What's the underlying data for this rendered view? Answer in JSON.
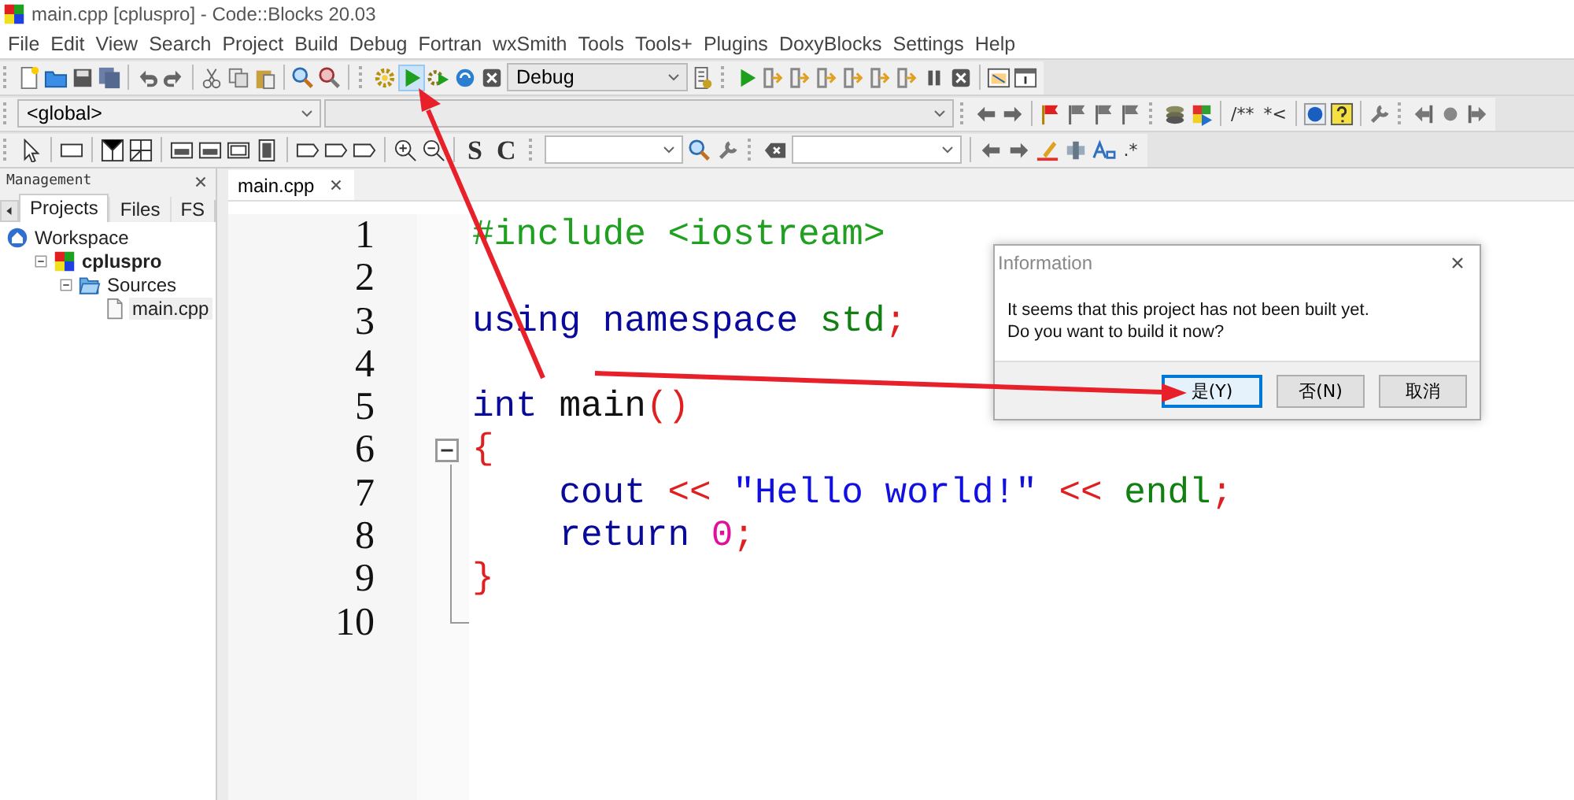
{
  "window": {
    "title": "main.cpp [cpluspro] - Code::Blocks 20.03"
  },
  "menu_bar": [
    "File",
    "Edit",
    "View",
    "Search",
    "Project",
    "Build",
    "Debug",
    "Fortran",
    "wxSmith",
    "Tools",
    "Tools+",
    "Plugins",
    "DoxyBlocks",
    "Settings",
    "Help"
  ],
  "toolbar_1": {
    "run_button": {
      "highlighted": true
    },
    "build_target": "Debug"
  },
  "toolbar_2": {
    "scope": "<global>",
    "buttons": [
      "/**",
      "*<"
    ]
  },
  "toolbar_3": {
    "buttons": [
      "S",
      "C",
      ".*"
    ]
  },
  "management": {
    "title": "Management",
    "tabs": [
      {
        "label": "Projects",
        "selected": true
      },
      {
        "label": "Files",
        "selected": false
      },
      {
        "label": "FS",
        "selected": false
      }
    ],
    "tree": [
      {
        "label": "Workspace",
        "kind": "workspace",
        "selected": false,
        "children": [
          {
            "label": "cpluspro",
            "kind": "project",
            "selected": false,
            "expanded": true,
            "children": [
              {
                "label": "Sources",
                "kind": "folder",
                "selected": false,
                "expanded": true,
                "children": [
                  {
                    "label": "main.cpp",
                    "kind": "file",
                    "selected": true
                  }
                ]
              }
            ]
          }
        ]
      }
    ]
  },
  "editor": {
    "tabs": [
      {
        "label": "main.cpp",
        "selected": true
      }
    ],
    "lines": [
      {
        "number": "1",
        "tokens": [
          {
            "text": "#include <iostream>",
            "kind": "preprocessor"
          }
        ]
      },
      {
        "number": "2"
      },
      {
        "number": "3",
        "tokens": [
          {
            "text": "using",
            "kind": "keyword"
          },
          {
            "text": " namespace",
            "kind": "keyword"
          },
          {
            "text": " std",
            "kind": "keyword2"
          },
          {
            "text": ";",
            "kind": "operator"
          }
        ]
      },
      {
        "number": "4"
      },
      {
        "number": "5",
        "tokens": [
          {
            "text": "int",
            "kind": "keyword"
          },
          {
            "text": " main",
            "kind": "plain"
          },
          {
            "text": "()",
            "kind": "operator"
          }
        ]
      },
      {
        "number": "6",
        "fold_marker": true,
        "tokens": [
          {
            "text": "{",
            "kind": "operator"
          }
        ]
      },
      {
        "number": "7",
        "in_fold": true,
        "indented": true,
        "tokens": [
          {
            "text": "cout",
            "kind": "keyword"
          },
          {
            "text": " <<",
            "kind": "operator"
          },
          {
            "text": " \"Hello world!\"",
            "kind": "string"
          },
          {
            "text": " <<",
            "kind": "operator"
          },
          {
            "text": " endl",
            "kind": "keyword2"
          },
          {
            "text": ";",
            "kind": "operator"
          }
        ]
      },
      {
        "number": "8",
        "in_fold": true,
        "indented": true,
        "tokens": [
          {
            "text": "return",
            "kind": "keyword"
          },
          {
            "text": " 0",
            "kind": "number"
          },
          {
            "text": ";",
            "kind": "operator"
          }
        ]
      },
      {
        "number": "9",
        "in_fold": true,
        "tokens": [
          {
            "text": "}",
            "kind": "operator"
          }
        ]
      },
      {
        "number": "10",
        "in_fold": true
      }
    ]
  },
  "dialog": {
    "title": "Information",
    "message": "It seems that this project has not been built yet.\nDo you want to build it now?",
    "buttons": [
      {
        "label": "是(Y)",
        "selected": true
      },
      {
        "label": "否(N)",
        "selected": false
      },
      {
        "label": "取消",
        "selected": false
      }
    ]
  }
}
